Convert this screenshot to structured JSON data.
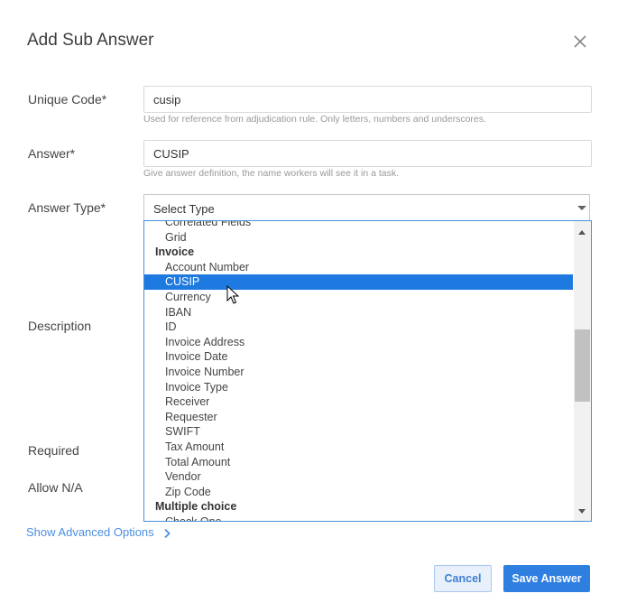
{
  "dialog": {
    "title": "Add Sub Answer"
  },
  "fields": {
    "unique_code": {
      "label": "Unique Code*",
      "value": "cusip",
      "hint": "Used for reference from adjudication rule. Only letters, numbers and underscores."
    },
    "answer": {
      "label": "Answer*",
      "value": "CUSIP",
      "hint": "Give answer definition, the name workers will see it in a task."
    },
    "answer_type": {
      "label": "Answer Type*",
      "placeholder": "Select Type",
      "options": [
        {
          "label": "Correlated Fields",
          "group": false
        },
        {
          "label": "Grid",
          "group": false
        },
        {
          "label": "Invoice",
          "group": true
        },
        {
          "label": "Account Number",
          "group": false
        },
        {
          "label": "CUSIP",
          "group": false,
          "selected": true
        },
        {
          "label": "Currency",
          "group": false
        },
        {
          "label": "IBAN",
          "group": false
        },
        {
          "label": "ID",
          "group": false
        },
        {
          "label": "Invoice Address",
          "group": false
        },
        {
          "label": "Invoice Date",
          "group": false
        },
        {
          "label": "Invoice Number",
          "group": false
        },
        {
          "label": "Invoice Type",
          "group": false
        },
        {
          "label": "Receiver",
          "group": false
        },
        {
          "label": "Requester",
          "group": false
        },
        {
          "label": "SWIFT",
          "group": false
        },
        {
          "label": "Tax Amount",
          "group": false
        },
        {
          "label": "Total Amount",
          "group": false
        },
        {
          "label": "Vendor",
          "group": false
        },
        {
          "label": "Zip Code",
          "group": false
        },
        {
          "label": "Multiple choice",
          "group": true
        },
        {
          "label": "Check One",
          "group": false
        }
      ]
    },
    "description": {
      "label": "Description"
    },
    "required": {
      "label": "Required"
    },
    "allow_na": {
      "label": "Allow N/A"
    }
  },
  "advanced": {
    "label": "Show Advanced Options"
  },
  "buttons": {
    "cancel": "Cancel",
    "save": "Save Answer"
  },
  "colors": {
    "accent": "#2f7fe0",
    "selected_option_bg": "#1e7ae0",
    "link": "#4a8fe0"
  }
}
